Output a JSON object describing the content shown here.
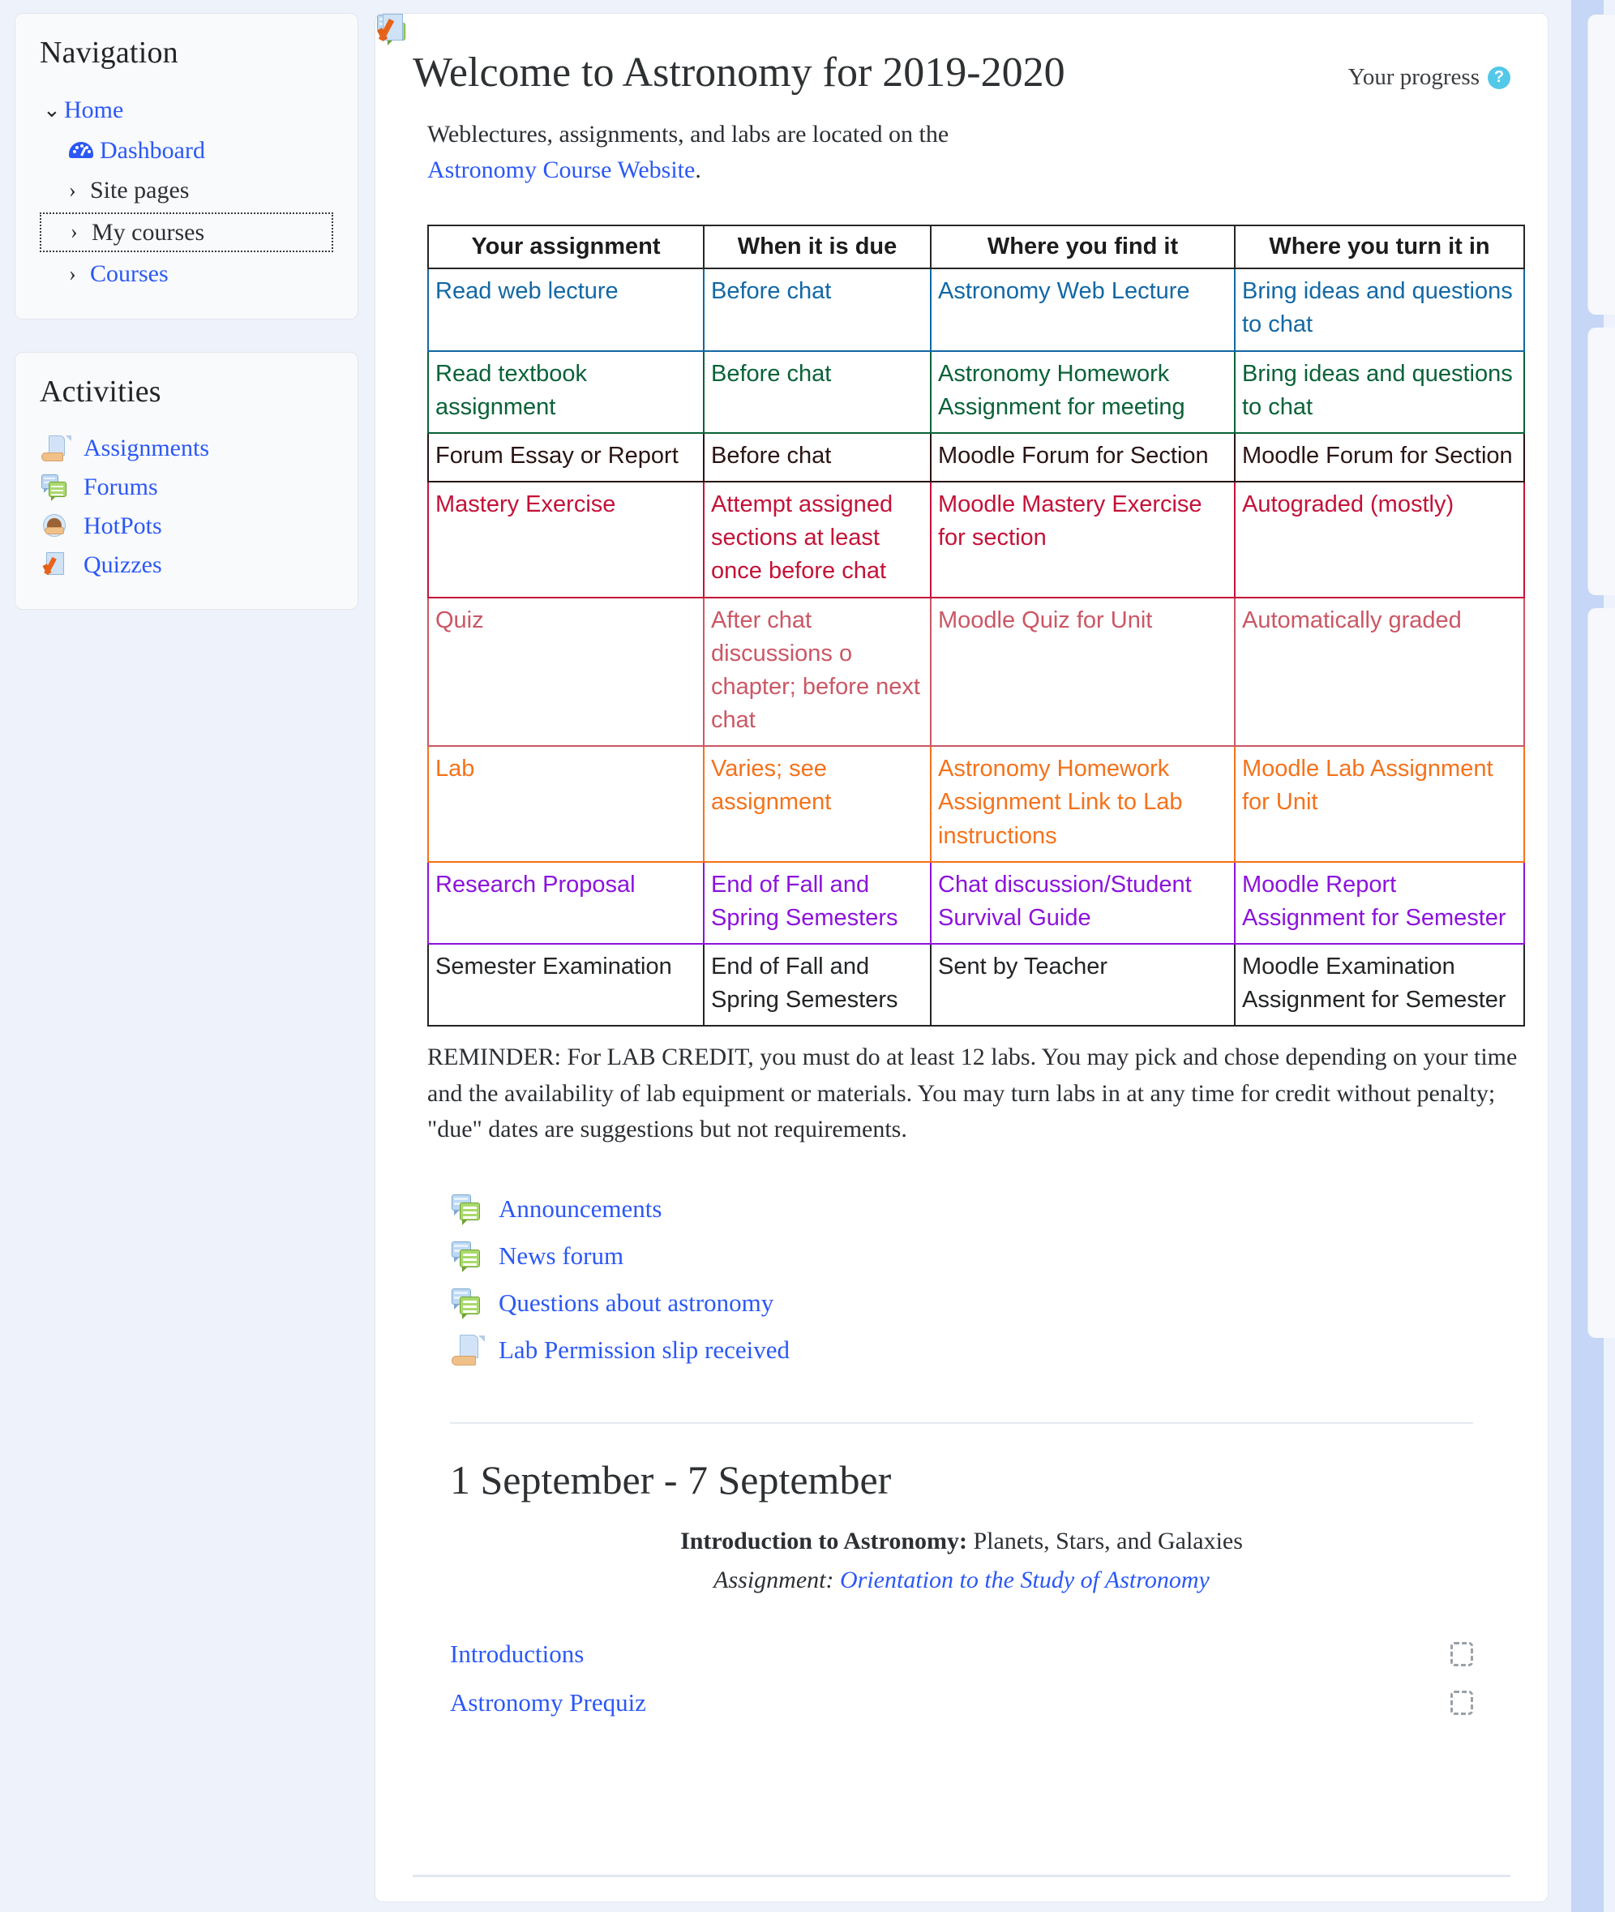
{
  "sidebar": {
    "navigation": {
      "title": "Navigation",
      "items": [
        {
          "label": "Home",
          "level": 0,
          "chevron": "v",
          "link": true,
          "icon": "none",
          "boxed": false
        },
        {
          "label": "Dashboard",
          "level": 1,
          "chevron": "",
          "link": true,
          "icon": "dashboard-gauge-icon",
          "boxed": false
        },
        {
          "label": "Site pages",
          "level": 2,
          "chevron": ">",
          "link": false,
          "icon": "none",
          "boxed": false
        },
        {
          "label": "My courses",
          "level": 2,
          "chevron": ">",
          "link": false,
          "icon": "none",
          "boxed": true
        },
        {
          "label": "Courses",
          "level": 2,
          "chevron": ">",
          "link": true,
          "icon": "none",
          "boxed": false
        }
      ]
    },
    "activities": {
      "title": "Activities",
      "items": [
        {
          "label": "Assignments",
          "icon": "assignment-icon"
        },
        {
          "label": "Forums",
          "icon": "forum-icon"
        },
        {
          "label": "HotPots",
          "icon": "hotpot-icon"
        },
        {
          "label": "Quizzes",
          "icon": "quiz-icon"
        }
      ]
    }
  },
  "main": {
    "page_title": "Welcome to Astronomy for 2019-2020",
    "progress": {
      "label": "Your progress",
      "help_icon": "question-mark-icon",
      "help_glyph": "?",
      "color": "#54c8e8"
    },
    "intro": {
      "text_before": "Weblectures, assignments, and labs are located on the ",
      "link_text": "Astronomy Course Website",
      "text_after": "."
    },
    "table": {
      "headers": [
        "Your assignment",
        "When it is due",
        "Where you find it",
        "Where you turn it in"
      ],
      "rows": [
        {
          "color_class": "r-blue",
          "color": "#1268a5",
          "cells": [
            "Read web lecture",
            "Before chat",
            "Astronomy Web Lecture",
            "Bring ideas and questions to chat"
          ]
        },
        {
          "color_class": "r-green",
          "color": "#0a6238",
          "cells": [
            "Read textbook assignment",
            "Before chat",
            "Astronomy Homework Assignment for meeting",
            "Bring ideas and questions to chat"
          ]
        },
        {
          "color_class": "r-dark",
          "color": "#2a1414",
          "cells": [
            "Forum Essay or Report",
            "Before chat",
            "Moodle Forum for Section",
            "Moodle Forum for Section"
          ]
        },
        {
          "color_class": "r-red",
          "color": "#c41238",
          "cells": [
            "Mastery Exercise",
            "Attempt assigned sections at least once before chat",
            "Moodle Mastery Exercise for section",
            "Autograded (mostly)"
          ]
        },
        {
          "color_class": "r-lred",
          "color": "#cb5765",
          "cells": [
            "Quiz",
            "After chat discussions o chapter; before next chat",
            "Moodle Quiz for Unit",
            "Automatically graded"
          ]
        },
        {
          "color_class": "r-orng",
          "color": "#f5721b",
          "cells": [
            "Lab",
            "Varies; see assignment",
            "Astronomy Homework Assignment Link to Lab instructions",
            "Moodle Lab Assignment for Unit"
          ]
        },
        {
          "color_class": "r-purp",
          "color": "#8c13dc",
          "cells": [
            "Research Proposal",
            "End of Fall and Spring Semesters",
            "Chat discussion/Student Survival Guide",
            "Moodle Report Assignment for Semester"
          ]
        },
        {
          "color_class": "r-black",
          "color": "#222426",
          "cells": [
            "Semester Examination",
            "End of Fall and Spring Semesters",
            "Sent by Teacher",
            "Moodle Examination Assignment for Semester"
          ]
        }
      ]
    },
    "reminder": "REMINDER: For LAB CREDIT, you must do at least 12 labs. You may pick and chose depending on your time and the availability of lab equipment or materials. You may turn labs in at any time for credit without penalty; \"due\" dates are suggestions but not requirements.",
    "activity_links": [
      {
        "label": "Announcements",
        "icon": "forum-icon"
      },
      {
        "label": "News forum",
        "icon": "forum-icon"
      },
      {
        "label": "Questions about astronomy",
        "icon": "forum-icon"
      },
      {
        "label": "Lab Permission slip received",
        "icon": "assignment-icon"
      }
    ],
    "week": {
      "title": "1 September - 7 September",
      "summary_bold": "Introduction to Astronomy:",
      "summary_rest": " Planets, Stars, and Galaxies",
      "assignment_label": "Assignment: ",
      "assignment_link": "Orientation to the Study of Astronomy",
      "activities": [
        {
          "label": "Introductions",
          "icon": "forum-icon",
          "completion": "incomplete-dashed-box"
        },
        {
          "label": "Astronomy Prequiz",
          "icon": "quiz-icon",
          "completion": "incomplete-dashed-box"
        }
      ]
    }
  }
}
